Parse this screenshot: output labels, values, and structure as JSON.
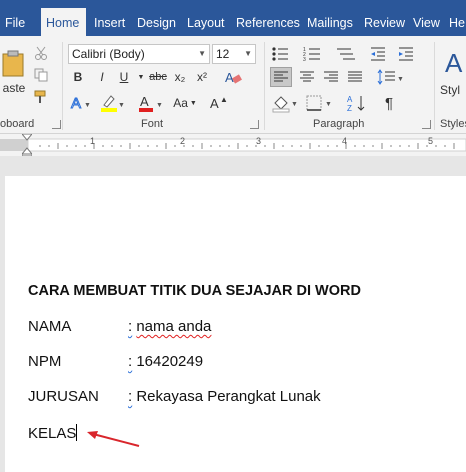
{
  "tabs": [
    {
      "label": "File",
      "active": false
    },
    {
      "label": "Home",
      "active": true
    },
    {
      "label": "Insert",
      "active": false
    },
    {
      "label": "Design",
      "active": false
    },
    {
      "label": "Layout",
      "active": false
    },
    {
      "label": "References",
      "active": false
    },
    {
      "label": "Mailings",
      "active": false
    },
    {
      "label": "Review",
      "active": false
    },
    {
      "label": "View",
      "active": false
    },
    {
      "label": "He",
      "active": false
    }
  ],
  "ribbon": {
    "clipboard": {
      "paste_label": "aste",
      "group_label": "oboard"
    },
    "font": {
      "font_name": "Calibri (Body)",
      "font_size": "12",
      "bold": "B",
      "italic": "I",
      "underline": "U",
      "strike": "abc",
      "subscript": "x₂",
      "superscript": "x²",
      "case": "Aa",
      "group_label": "Font"
    },
    "paragraph": {
      "group_label": "Paragraph",
      "pilcrow": "¶"
    },
    "styles": {
      "label": "Styl",
      "group_label": "Styles"
    }
  },
  "ruler": {
    "numbers": [
      "1",
      "2",
      "3",
      "4",
      "5"
    ]
  },
  "document": {
    "heading": "CARA MEMBUAT TITIK DUA SEJAJAR DI WORD",
    "rows": [
      {
        "label": "NAMA",
        "colon": ":",
        "value": "nama anda"
      },
      {
        "label": "NPM",
        "colon": ":",
        "value": "16420249"
      },
      {
        "label": "JURUSAN",
        "colon": ":",
        "value": "Rekayasa Perangkat Lunak"
      }
    ],
    "last_line": "KELAS"
  },
  "colors": {
    "accent": "#2b579a",
    "annotation_arrow": "#d9262c"
  }
}
